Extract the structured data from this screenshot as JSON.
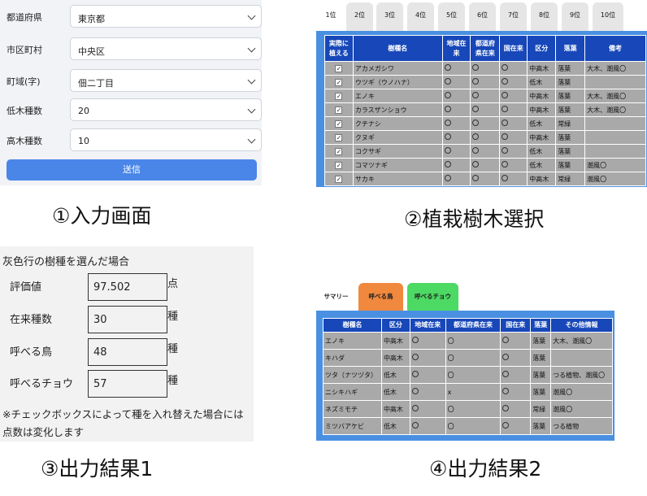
{
  "input_form": {
    "fields": [
      {
        "label": "都道府県",
        "value": "東京都"
      },
      {
        "label": "市区町村",
        "value": "中央区"
      },
      {
        "label": "町域(字)",
        "value": "佃二丁目"
      },
      {
        "label": "低木種数",
        "value": "20"
      },
      {
        "label": "高木種数",
        "value": "10"
      }
    ],
    "submit_label": "送信"
  },
  "captions": {
    "c1": "①入力画面",
    "c2": "②植栽樹木選択",
    "c3": "③出力結果1",
    "c4": "④出力結果2"
  },
  "selection": {
    "tabs": [
      "1位",
      "2位",
      "3位",
      "4位",
      "5位",
      "6位",
      "7位",
      "8位",
      "9位",
      "10位"
    ],
    "headers": [
      "実際に植える",
      "樹種名",
      "地域在来",
      "都道府県在来",
      "国在来",
      "区分",
      "落葉",
      "備考"
    ],
    "rows": [
      {
        "name": "アカメガシワ",
        "kubun": "中高木",
        "rakuyo": "落葉",
        "biko": "大木、潮風〇"
      },
      {
        "name": "ウツギ（ウノハナ）",
        "kubun": "低木",
        "rakuyo": "落葉",
        "biko": ""
      },
      {
        "name": "エノキ",
        "kubun": "中高木",
        "rakuyo": "落葉",
        "biko": "大木、潮風〇"
      },
      {
        "name": "カラスザンショウ",
        "kubun": "中高木",
        "rakuyo": "落葉",
        "biko": "大木、潮風〇"
      },
      {
        "name": "クチナシ",
        "kubun": "低木",
        "rakuyo": "常緑",
        "biko": ""
      },
      {
        "name": "クヌギ",
        "kubun": "中高木",
        "rakuyo": "落葉",
        "biko": ""
      },
      {
        "name": "コクサギ",
        "kubun": "低木",
        "rakuyo": "落葉",
        "biko": ""
      },
      {
        "name": "コマツナギ",
        "kubun": "低木",
        "rakuyo": "落葉",
        "biko": "潮風〇"
      },
      {
        "name": "サカキ",
        "kubun": "中高木",
        "rakuyo": "常緑",
        "biko": "潮風〇"
      }
    ]
  },
  "result1": {
    "title": "灰色行の樹種を選んだ場合",
    "rows": [
      {
        "label": "評価値",
        "value": "97.502",
        "unit": "点"
      },
      {
        "label": "在来種数",
        "value": "30",
        "unit": "種"
      },
      {
        "label": "呼べる鳥",
        "value": "48",
        "unit": "種"
      },
      {
        "label": "呼べるチョウ",
        "value": "57",
        "unit": "種"
      }
    ],
    "note": "※チェックボックスによって種を入れ替えた場合には点数は変化します"
  },
  "result2": {
    "tabs": [
      {
        "label": "サマリー",
        "color": "#ffffff"
      },
      {
        "label": "呼べる鳥",
        "color": "#f0883e"
      },
      {
        "label": "呼べるチョウ",
        "color": "#4cd964"
      }
    ],
    "headers": [
      "樹種名",
      "区分",
      "地域在来",
      "都道府県在来",
      "国在来",
      "落葉",
      "その他情報"
    ],
    "rows": [
      {
        "name": "エノキ",
        "kubun": "中高木",
        "pref": "〇",
        "rakuyo": "落葉",
        "info": "大木、潮風〇"
      },
      {
        "name": "キハダ",
        "kubun": "中高木",
        "pref": "〇",
        "rakuyo": "落葉",
        "info": ""
      },
      {
        "name": "ツタ（ナツヅタ）",
        "kubun": "低木",
        "pref": "〇",
        "rakuyo": "落葉",
        "info": "つる植物、潮風〇"
      },
      {
        "name": "ニシキハギ",
        "kubun": "低木",
        "pref": "x",
        "rakuyo": "落葉",
        "info": "潮風〇"
      },
      {
        "name": "ネズミモチ",
        "kubun": "中高木",
        "pref": "〇",
        "rakuyo": "常緑",
        "info": "潮風〇"
      },
      {
        "name": "ミツバアケビ",
        "kubun": "低木",
        "pref": "〇",
        "rakuyo": "落葉",
        "info": "つる植物"
      }
    ]
  },
  "colors": {
    "accent": "#4a86e8",
    "header": "#1747b8",
    "frame": "#4a90e2",
    "row": "#a9a9a9"
  }
}
